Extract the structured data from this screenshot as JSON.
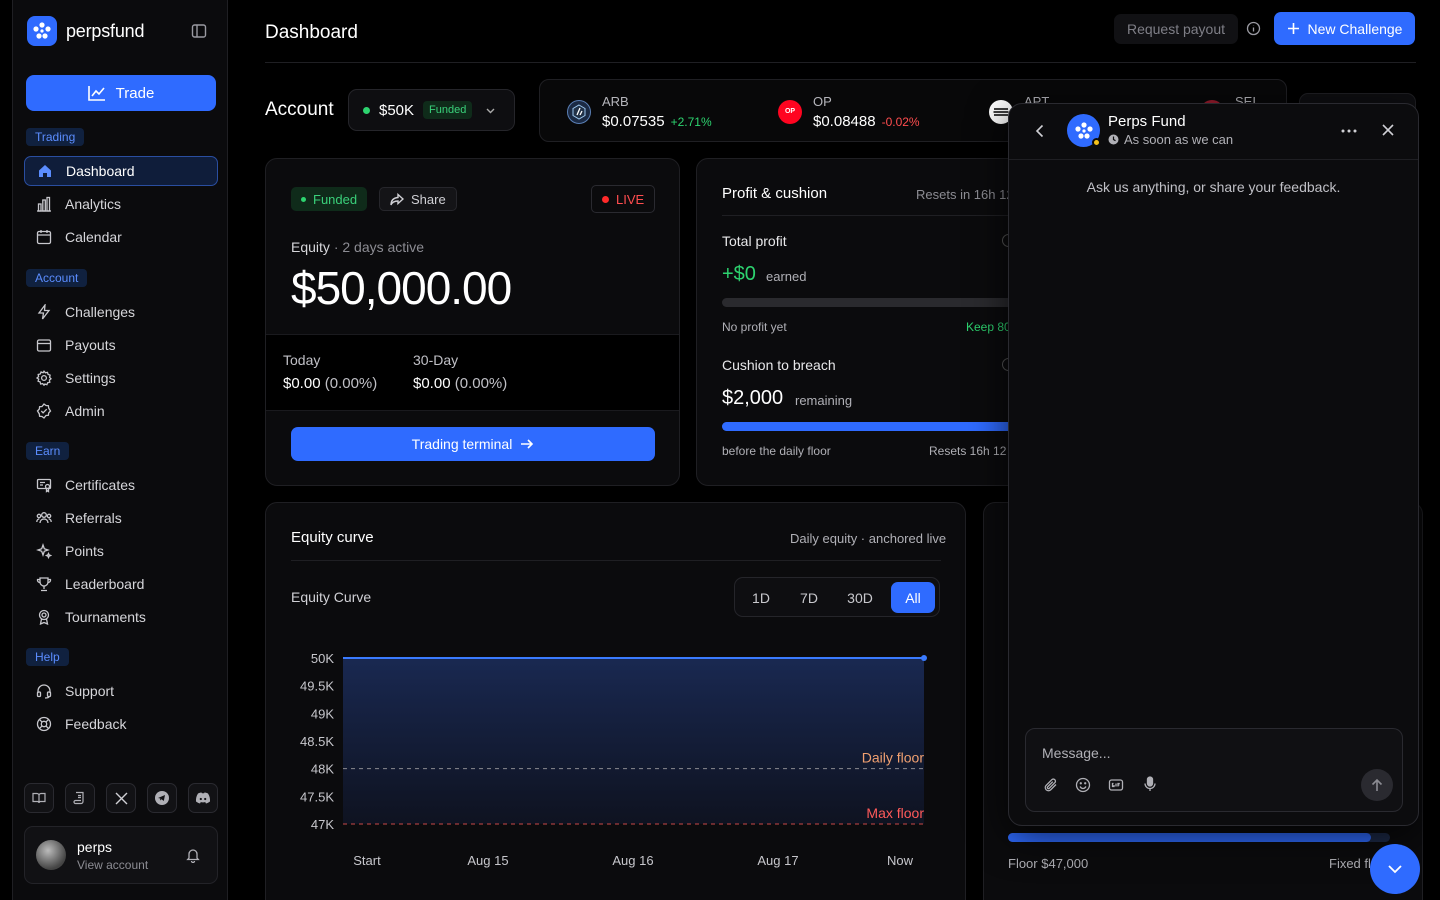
{
  "brand": {
    "name": "perpsfund"
  },
  "sidebar": {
    "trade_label": "Trade",
    "sections": {
      "trading": "Trading",
      "account": "Account",
      "earn": "Earn",
      "help": "Help"
    },
    "items": {
      "dashboard": "Dashboard",
      "analytics": "Analytics",
      "calendar": "Calendar",
      "challenges": "Challenges",
      "payouts": "Payouts",
      "settings": "Settings",
      "admin": "Admin",
      "certificates": "Certificates",
      "referrals": "Referrals",
      "points": "Points",
      "leaderboard": "Leaderboard",
      "tournaments": "Tournaments",
      "support": "Support",
      "feedback": "Feedback"
    },
    "user": {
      "name": "perps",
      "sub": "View account"
    }
  },
  "header": {
    "title": "Dashboard",
    "request_payout": "Request payout",
    "new_challenge": "New Challenge"
  },
  "account": {
    "label": "Account",
    "size": "$50K",
    "tag": "Funded"
  },
  "ticker": [
    {
      "symbol": "ARB",
      "price": "$0.07535",
      "change": "+2.71%",
      "dir": "up"
    },
    {
      "symbol": "OP",
      "price": "$0.08488",
      "change": "-0.02%",
      "dir": "down"
    },
    {
      "symbol": "APT",
      "price": "",
      "change": "",
      "dir": "up"
    },
    {
      "symbol": "SEI",
      "price": "",
      "change": "",
      "dir": "up"
    }
  ],
  "equity_card": {
    "status": "Funded",
    "share": "Share",
    "live": "LIVE",
    "equity_label": "Equity",
    "active": "· 2 days active",
    "equity_value": "$50,000.00",
    "today_label": "Today",
    "today_value": "$0.00",
    "today_pct": "(0.00%)",
    "d30_label": "30-Day",
    "d30_value": "$0.00",
    "d30_pct": "(0.00%)",
    "terminal_btn": "Trading terminal"
  },
  "profit_card": {
    "title": "Profit & cushion",
    "resets_top": "Resets in 16h 12",
    "total_profit_label": "Total profit",
    "total_profit_value": "+$0",
    "earned": "earned",
    "no_profit": "No profit yet",
    "keep": "Keep 80",
    "profit_progress": 0,
    "cushion_label": "Cushion to breach",
    "cushion_value": "$2,000",
    "remaining": "remaining",
    "cushion_progress": 1,
    "before_floor": "before the daily floor",
    "resets_bottom": "Resets 16h 12"
  },
  "equity_chart": {
    "title": "Equity curve",
    "subtitle": "Daily equity · anchored live",
    "inner_title": "Equity Curve",
    "ranges": [
      "1D",
      "7D",
      "30D",
      "All"
    ],
    "active_range": "All",
    "daily_floor_label": "Daily floor",
    "max_floor_label": "Max floor"
  },
  "chart_data": {
    "type": "area",
    "x": [
      "Start",
      "Aug 15",
      "Aug 16",
      "Aug 17",
      "Now"
    ],
    "series": [
      {
        "values": [
          50000,
          50000,
          50000,
          50000,
          50000
        ]
      }
    ],
    "y_ticks": [
      "50K",
      "49.5K",
      "49K",
      "48.5K",
      "48K",
      "47.5K",
      "47K"
    ],
    "ylim": [
      47000,
      50000
    ],
    "reference_lines": [
      {
        "label": "Daily floor",
        "value": 48000
      },
      {
        "label": "Max floor",
        "value": 47000
      }
    ],
    "grid": false
  },
  "floor_card": {
    "floor": "Floor $47,000",
    "fixed": "Fixed fl",
    "progress": 0.95
  },
  "chat": {
    "name": "Perps Fund",
    "status": "As soon as we can",
    "intro": "Ask us anything, or share your feedback.",
    "placeholder": "Message..."
  },
  "colors": {
    "accent": "#2f6bff",
    "green": "#2dd36f",
    "red": "#ff4d4f",
    "daily_floor": "#f0a070",
    "max_floor": "#ff5a5a"
  }
}
